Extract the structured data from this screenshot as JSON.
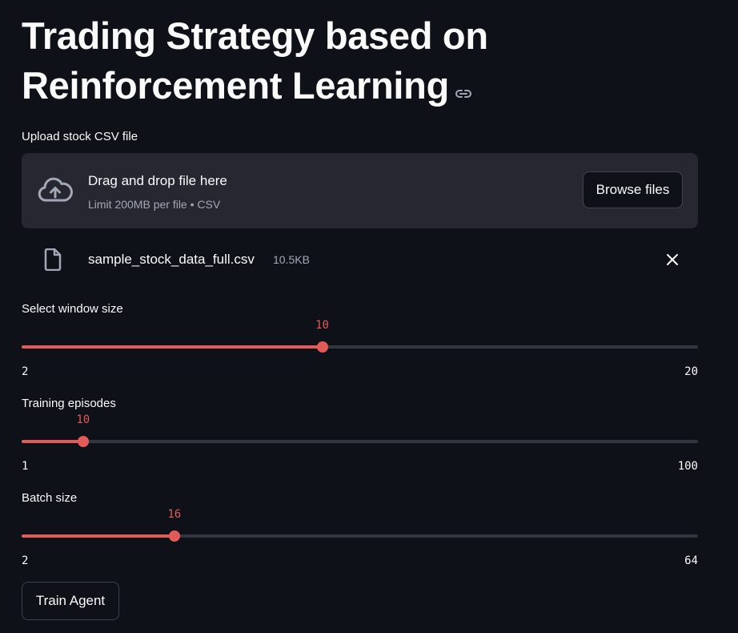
{
  "title": {
    "line1": "Trading Strategy based on",
    "line2": "Reinforcement Learning"
  },
  "upload": {
    "label": "Upload stock CSV file",
    "drag_text": "Drag and drop file here",
    "limit_text": "Limit 200MB per file • CSV",
    "browse_label": "Browse files",
    "file_name": "sample_stock_data_full.csv",
    "file_size": "10.5KB"
  },
  "sliders": [
    {
      "label": "Select window size",
      "value": 10,
      "min": 2,
      "max": 20
    },
    {
      "label": "Training episodes",
      "value": 10,
      "min": 1,
      "max": 100
    },
    {
      "label": "Batch size",
      "value": 16,
      "min": 2,
      "max": 64
    }
  ],
  "train_button": "Train Agent",
  "colors": {
    "background": "#0e1117",
    "accent": "#e35b58",
    "surface": "#262730"
  },
  "icons": {
    "header_link": "link-icon",
    "upload": "cloud-upload-icon",
    "file": "file-icon",
    "remove": "close-icon"
  }
}
